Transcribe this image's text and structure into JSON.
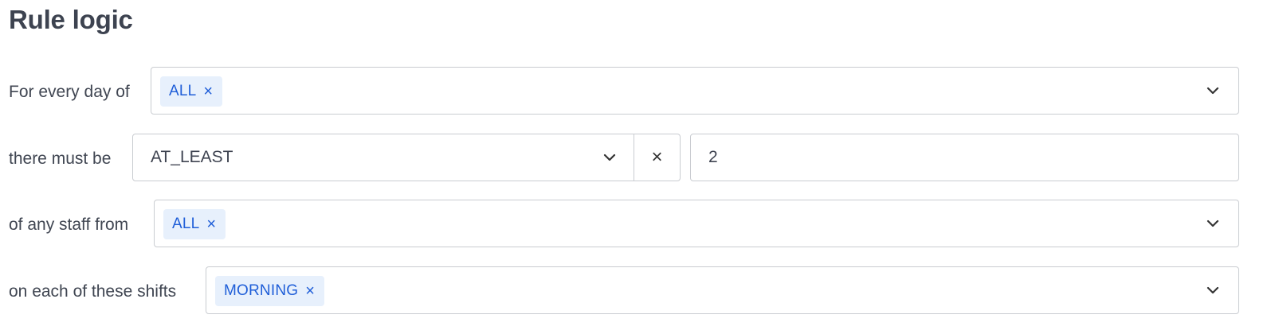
{
  "section": {
    "title": "Rule logic"
  },
  "rows": {
    "days": {
      "label": "For every day of",
      "chips": [
        {
          "label": "ALL",
          "remove": "×"
        }
      ]
    },
    "quantity": {
      "label": "there must be",
      "operator_value": "AT_LEAST",
      "clear": "×",
      "count_value": "2"
    },
    "staff": {
      "label": "of any staff from",
      "chips": [
        {
          "label": "ALL",
          "remove": "×"
        }
      ]
    },
    "shifts": {
      "label": "on each of these shifts",
      "chips": [
        {
          "label": "MORNING",
          "remove": "×"
        }
      ]
    }
  },
  "colors": {
    "chip_bg": "#e7f0fc",
    "chip_text": "#1f5ed8",
    "border": "#c9ccd1",
    "text": "#404652"
  }
}
